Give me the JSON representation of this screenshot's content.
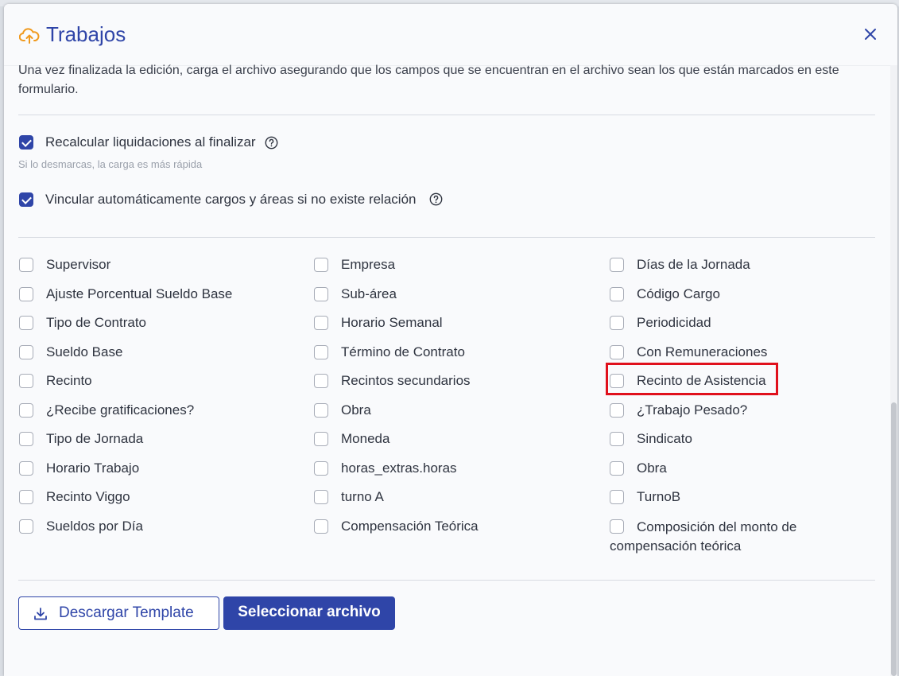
{
  "header": {
    "title": "Trabajos",
    "icon": "cloud-upload-icon",
    "close_icon": "close-icon"
  },
  "intro": "Una vez finalizada la edición, carga el archivo asegurando que los campos que se encuentran en el archivo sean los que están marcados en este formulario.",
  "options": {
    "recalc_label": "Recalcular liquidaciones al finalizar",
    "recalc_checked": true,
    "recalc_hint": "Si lo desmarcas, la carga es más rápida",
    "link_label": "Vincular automáticamente cargos y áreas si no existe relación",
    "link_checked": true
  },
  "fields": {
    "col1": [
      "Supervisor",
      "Ajuste Porcentual Sueldo Base",
      "Tipo de Contrato",
      "Sueldo Base",
      "Recinto",
      "¿Recibe gratificaciones?",
      "Tipo de Jornada",
      "Horario Trabajo",
      "Recinto Viggo",
      "Sueldos por Día"
    ],
    "col2": [
      "Empresa",
      "Sub-área",
      "Horario Semanal",
      "Término de Contrato",
      "Recintos secundarios",
      "Obra",
      "Moneda",
      "horas_extras.horas",
      "turno A",
      "Compensación Teórica"
    ],
    "col3": [
      "Días de la Jornada",
      "Código Cargo",
      "Periodicidad",
      "Con Remuneraciones",
      "Recinto de Asistencia",
      "¿Trabajo Pesado?",
      "Sindicato",
      "Obra",
      "TurnoB",
      "Composición del monto de compensación teórica"
    ]
  },
  "buttons": {
    "download_label": "Descargar Template",
    "select_label": "Seleccionar archivo"
  },
  "colors": {
    "primary": "#2f45a8",
    "highlight": "#e0101c"
  }
}
